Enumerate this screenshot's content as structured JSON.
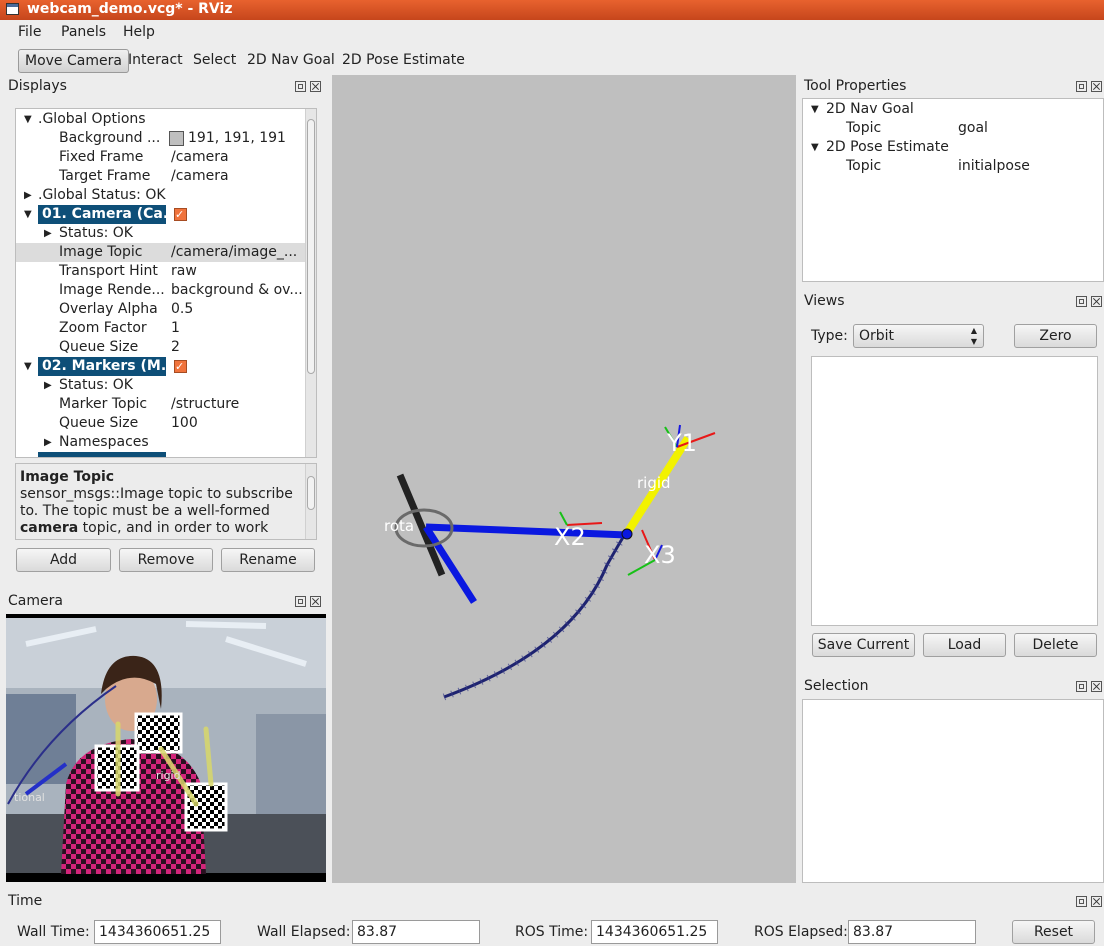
{
  "window": {
    "title": "webcam_demo.vcg* - RViz"
  },
  "menu": {
    "file": "File",
    "panels": "Panels",
    "help": "Help"
  },
  "toolbar": {
    "move_camera": "Move Camera",
    "interact": "Interact",
    "select": "Select",
    "nav_goal": "2D Nav Goal",
    "pose_estimate": "2D Pose Estimate"
  },
  "displays": {
    "title": "Displays",
    "rows": [
      {
        "label": ".Global Options"
      },
      {
        "label": "Background ...",
        "value": "191, 191, 191",
        "swatch": "#bfbfbf"
      },
      {
        "label": "Fixed Frame",
        "value": "/camera"
      },
      {
        "label": "Target Frame",
        "value": "/camera"
      },
      {
        "label": ".Global Status: OK"
      },
      {
        "label": "01. Camera (Ca..."
      },
      {
        "label": "Status: OK"
      },
      {
        "label": "Image Topic",
        "value": "/camera/image_..."
      },
      {
        "label": "Transport Hint",
        "value": "raw"
      },
      {
        "label": "Image Rende...",
        "value": "background & ov..."
      },
      {
        "label": "Overlay Alpha",
        "value": "0.5"
      },
      {
        "label": "Zoom Factor",
        "value": "1"
      },
      {
        "label": "Queue Size",
        "value": "2"
      },
      {
        "label": "02. Markers (M..."
      },
      {
        "label": "Status: OK"
      },
      {
        "label": "Marker Topic",
        "value": "/structure"
      },
      {
        "label": "Queue Size",
        "value": "100"
      },
      {
        "label": "Namespaces"
      }
    ],
    "help_title": "Image Topic",
    "help_text_1": "sensor_msgs::Image topic to subscribe",
    "help_text_2": "to. The topic must be a well-formed",
    "help_bold": "camera",
    "help_text_3": " topic, and in order to work",
    "add": "Add",
    "remove": "Remove",
    "rename": "Rename"
  },
  "camera": {
    "title": "Camera",
    "overlay_label": "rigid",
    "overlay_label2": "tional"
  },
  "viewport": {
    "labels": {
      "y1": "Y1",
      "x2": "X2",
      "x3": "X3",
      "rigid": "rigid",
      "rota": "rota"
    },
    "background": "#bfbfbf"
  },
  "tool_properties": {
    "title": "Tool Properties",
    "items": [
      {
        "label": "2D Nav Goal",
        "key": "Topic",
        "value": "goal"
      },
      {
        "label": "2D Pose Estimate",
        "key": "Topic",
        "value": "initialpose"
      }
    ]
  },
  "views": {
    "title": "Views",
    "type_label": "Type:",
    "type_value": "Orbit",
    "zero": "Zero",
    "save_current": "Save Current",
    "load": "Load",
    "delete": "Delete"
  },
  "selection": {
    "title": "Selection"
  },
  "time": {
    "title": "Time",
    "wall_time_label": "Wall Time:",
    "wall_time": "1434360651.25",
    "wall_elapsed_label": "Wall Elapsed:",
    "wall_elapsed": "83.87",
    "ros_time_label": "ROS Time:",
    "ros_time": "1434360651.25",
    "ros_elapsed_label": "ROS Elapsed:",
    "ros_elapsed": "83.87",
    "reset": "Reset"
  }
}
